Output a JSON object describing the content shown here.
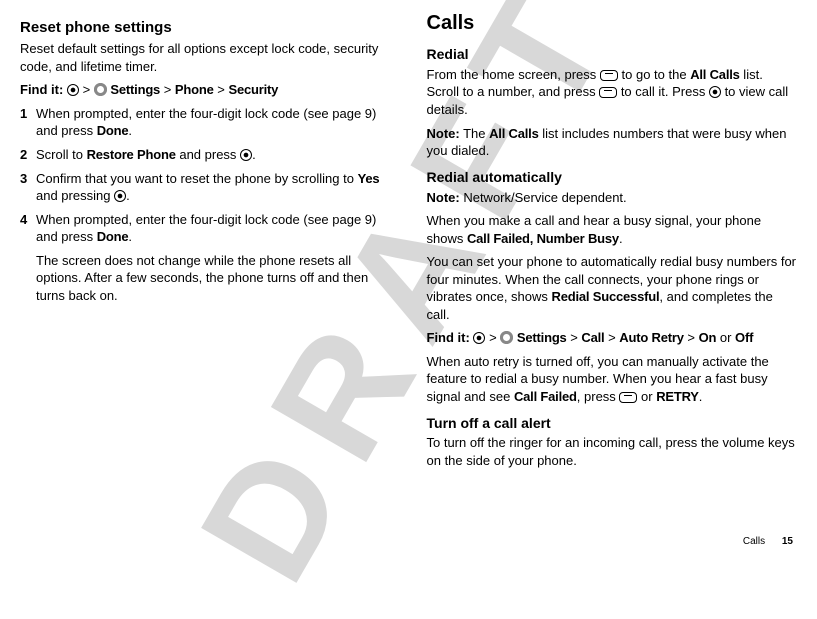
{
  "watermark": "DRAFT",
  "left": {
    "h2": "Reset phone settings",
    "intro": "Reset default settings for all options except lock code, security code, and lifetime timer.",
    "findit_label": "Find it:",
    "findit_settings": "Settings",
    "findit_phone": "Phone",
    "findit_security": "Security",
    "gt": " > ",
    "steps": [
      {
        "num": "1",
        "pre": "When prompted, enter the four-digit lock code (see page 9) and press ",
        "b1": "Done",
        "post": "."
      },
      {
        "num": "2",
        "pre": "Scroll to ",
        "b1": "Restore Phone",
        "mid": " and press ",
        "post": "."
      },
      {
        "num": "3",
        "pre": "Confirm that you want to reset the phone by scrolling to ",
        "b1": "Yes",
        "mid": " and pressing ",
        "post": "."
      },
      {
        "num": "4",
        "pre": "When prompted, enter the four-digit lock code (see page 9) and press ",
        "b1": "Done",
        "post": "."
      }
    ],
    "after": "The screen does not change while the phone resets all options. After a few seconds, the phone turns off and then turns back on."
  },
  "right": {
    "h1": "Calls",
    "redial_h": "Redial",
    "redial_p1a": "From the home screen, press ",
    "redial_p1b": " to go to the ",
    "redial_allcalls": "All Calls",
    "redial_p1c": " list. Scroll to a number, and press ",
    "redial_p1d": " to call it. Press ",
    "redial_p1e": " to view call details.",
    "note_label": "Note:",
    "redial_note_a": " The ",
    "redial_note_b": " list includes numbers that were busy when you dialed.",
    "auto_h": "Redial automatically",
    "auto_note": " Network/Service dependent.",
    "auto_p1a": "When you make a call and hear a busy signal, your phone shows ",
    "auto_p1b": "Call Failed, Number Busy",
    "auto_p1c": ".",
    "auto_p2a": "You can set your phone to automatically redial busy numbers for four minutes. When the call connects, your phone rings or vibrates once, shows ",
    "auto_p2b": "Redial Successful",
    "auto_p2c": ", and completes the call.",
    "findit_label": "Find it:",
    "findit_settings": "Settings",
    "findit_call": "Call",
    "findit_autoretry": "Auto Retry",
    "findit_on": "On",
    "findit_or": " or ",
    "findit_off": "Off",
    "auto_p3a": "When auto retry is turned off, you can manually activate the feature to redial a busy number. When you hear a fast busy signal and see ",
    "auto_p3b": "Call Failed",
    "auto_p3c": ", press ",
    "auto_p3d": " or ",
    "auto_p3e": "RETRY",
    "auto_p3f": ".",
    "turnoff_h": "Turn off a call alert",
    "turnoff_p": "To turn off the ringer for an incoming call, press the volume keys on the side of your phone."
  },
  "footer": {
    "section": "Calls",
    "page": "15"
  }
}
